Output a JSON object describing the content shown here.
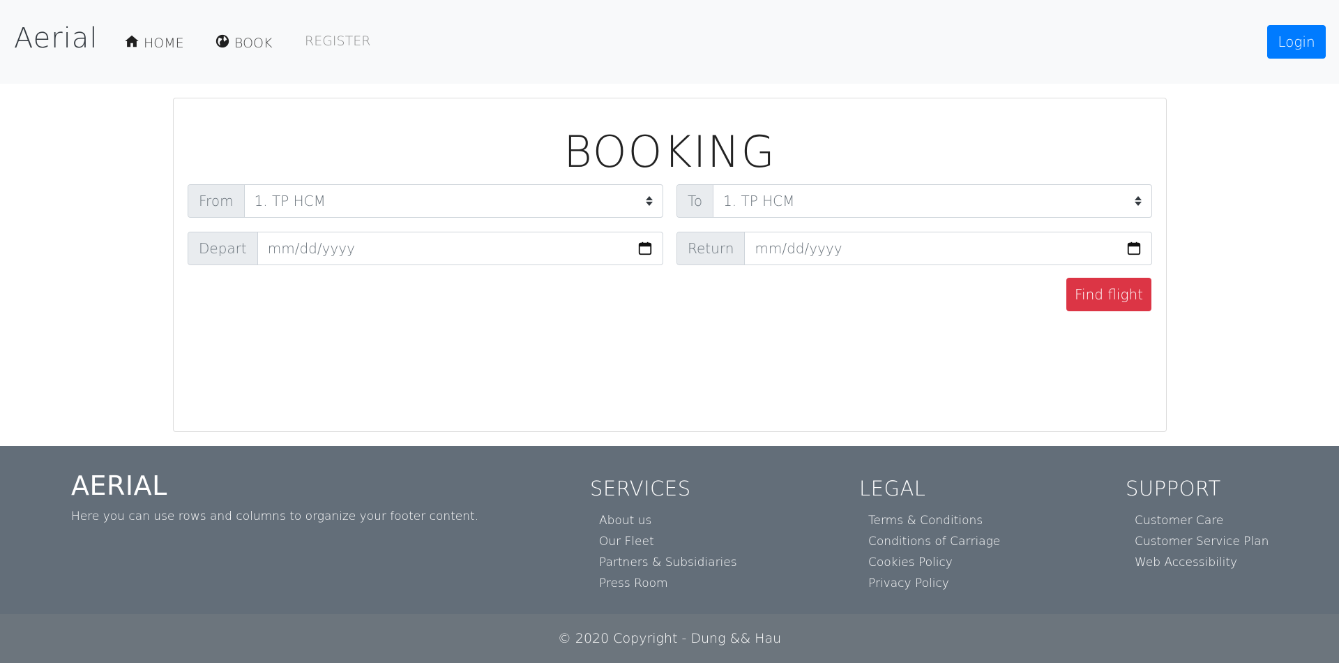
{
  "navbar": {
    "brand": "Aerial",
    "items": [
      {
        "label": "HOME",
        "icon": "home-icon"
      },
      {
        "label": "BOOK",
        "icon": "globe-icon"
      },
      {
        "label": "REGISTER"
      }
    ],
    "login_label": "Login"
  },
  "booking": {
    "title": "BOOKING",
    "from_label": "From",
    "from_value": "1. TP HCM",
    "to_label": "To",
    "to_value": "1. TP HCM",
    "depart_label": "Depart",
    "depart_placeholder": "mm/dd/yyyy",
    "return_label": "Return",
    "return_placeholder": "mm/dd/yyyy",
    "find_label": "Find flight"
  },
  "footer": {
    "brand": "AERIAL",
    "description": "Here you can use rows and columns to organize your footer content.",
    "columns": [
      {
        "heading": "SERVICES",
        "links": [
          "About us",
          "Our Fleet",
          "Partners & Subsidiaries",
          "Press Room"
        ]
      },
      {
        "heading": "LEGAL",
        "links": [
          "Terms & Conditions",
          "Conditions of Carriage",
          "Cookies Policy",
          "Privacy Policy"
        ]
      },
      {
        "heading": "SUPPORT",
        "links": [
          "Customer Care",
          "Customer Service Plan",
          "Web Accessibility"
        ]
      }
    ],
    "copyright": "© 2020 Copyright - Dung && Hau"
  },
  "colors": {
    "primary": "#007bff",
    "danger": "#dc3545",
    "footer_bg": "#636e79",
    "copyright_bg": "#6c757d",
    "navbar_bg": "#f8f9fa"
  }
}
